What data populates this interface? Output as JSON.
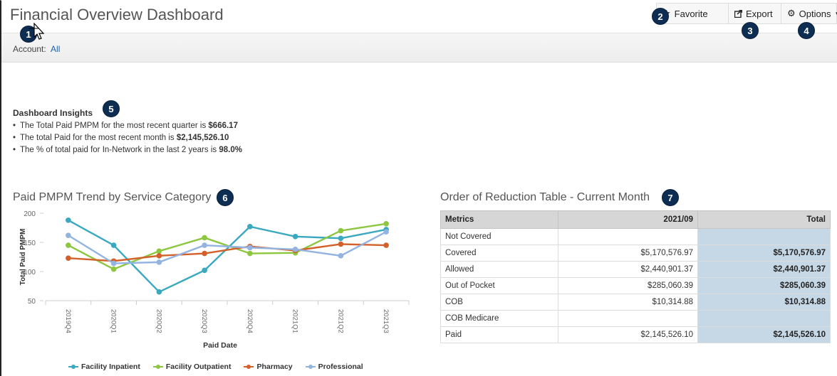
{
  "header": {
    "title": "Financial Overview Dashboard",
    "favorite_label": "Favorite",
    "export_label": "Export",
    "options_label": "Options"
  },
  "filter": {
    "account_label": "Account:",
    "account_value": "All"
  },
  "badges": [
    "1",
    "2",
    "3",
    "4",
    "5",
    "6",
    "7"
  ],
  "insights": {
    "title": "Dashboard Insights",
    "items": [
      {
        "text": "The Total Paid PMPM for the most recent quarter is ",
        "value": "$666.17"
      },
      {
        "text": "The total Paid for the most recent month is ",
        "value": "$2,145,526.10"
      },
      {
        "text": "The % of total paid for In-Network in the last 2 years is ",
        "value": "98.0%"
      }
    ]
  },
  "chart_title": "Paid PMPM Trend by Service Category",
  "table_title": "Order of Reduction Table - Current Month",
  "chart_data": {
    "type": "line",
    "title": "Paid PMPM Trend by Service Category",
    "xlabel": "Paid Date",
    "ylabel": "Total Paid PMPM",
    "categories": [
      "2019Q4",
      "2020Q1",
      "2020Q2",
      "2020Q3",
      "2020Q4",
      "2021Q1",
      "2021Q2",
      "2021Q3"
    ],
    "ylim": [
      50,
      200
    ],
    "yticks": [
      50,
      100,
      150,
      200
    ],
    "grid": false,
    "legend_position": "bottom",
    "series": [
      {
        "name": "Facility Inpatient",
        "color": "#3aa9c0",
        "values": [
          188,
          145,
          65,
          102,
          177,
          160,
          157,
          172
        ]
      },
      {
        "name": "Facility Outpatient",
        "color": "#8dc63f",
        "values": [
          145,
          104,
          135,
          158,
          131,
          132,
          170,
          182
        ]
      },
      {
        "name": "Pharmacy",
        "color": "#d3602a",
        "values": [
          123,
          118,
          127,
          131,
          143,
          136,
          147,
          145
        ]
      },
      {
        "name": "Professional",
        "color": "#93b4e0",
        "values": [
          162,
          114,
          116,
          145,
          141,
          138,
          127,
          168
        ]
      }
    ]
  },
  "table": {
    "headers": [
      "Metrics",
      "2021/09",
      "Total"
    ],
    "rows": [
      [
        "Not Covered",
        "",
        ""
      ],
      [
        "Covered",
        "$5,170,576.97",
        "$5,170,576.97"
      ],
      [
        "Allowed",
        "$2,440,901.37",
        "$2,440,901.37"
      ],
      [
        "Out of Pocket",
        "$285,060.39",
        "$285,060.39"
      ],
      [
        "COB",
        "$10,314.88",
        "$10,314.88"
      ],
      [
        "COB Medicare",
        "",
        ""
      ],
      [
        "Paid",
        "$2,145,526.10",
        "$2,145,526.10"
      ]
    ]
  }
}
